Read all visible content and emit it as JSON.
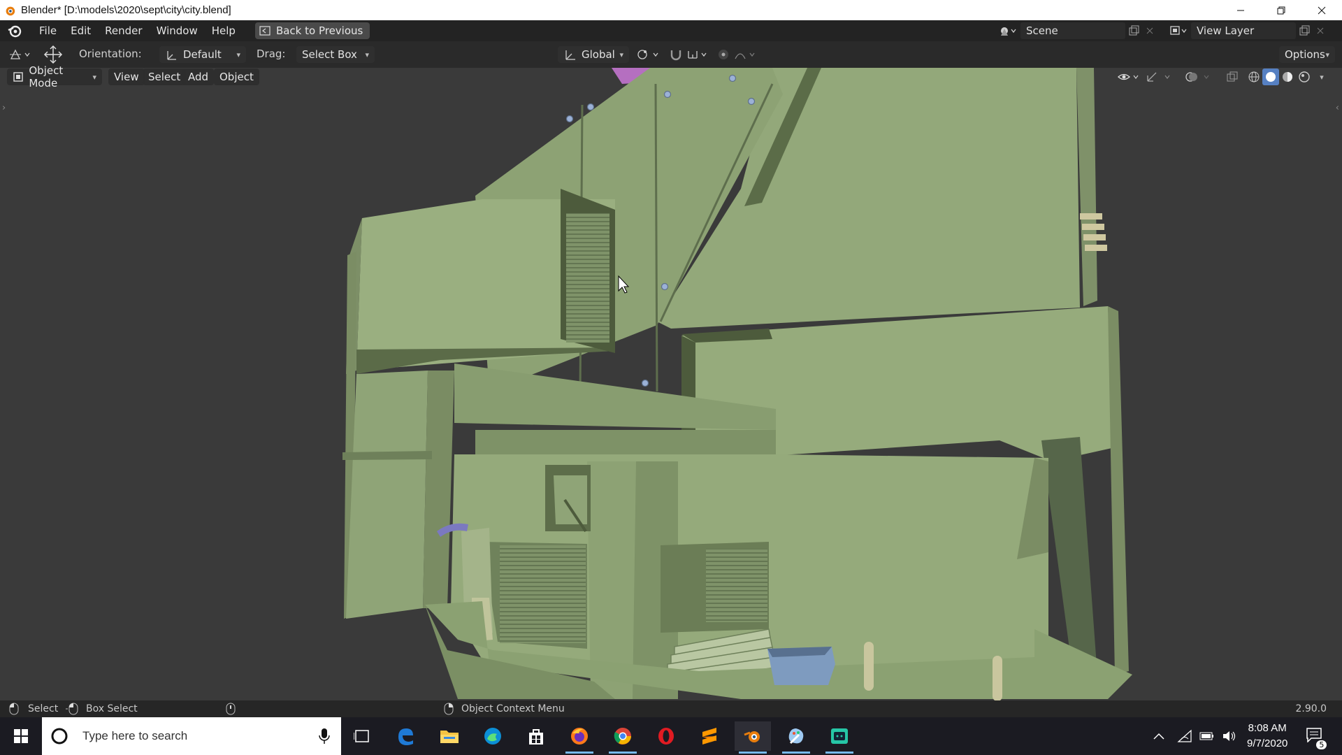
{
  "window": {
    "title": "Blender* [D:\\models\\2020\\sept\\city\\city.blend]"
  },
  "menubar": {
    "items": [
      "File",
      "Edit",
      "Render",
      "Window",
      "Help"
    ],
    "back_button": "Back to Previous",
    "scene": "Scene",
    "view_layer": "View Layer"
  },
  "toolheader": {
    "orientation_label": "Orientation:",
    "orientation_value": "Default",
    "drag_label": "Drag:",
    "drag_value": "Select Box",
    "transform_orientation": "Global",
    "options": "Options"
  },
  "viewport_header": {
    "mode": "Object Mode",
    "menus": [
      "View",
      "Select",
      "Add",
      "Object"
    ]
  },
  "statusbar": {
    "select": "Select",
    "box_select": "Box Select",
    "context_menu": "Object Context Menu",
    "version": "2.90.0"
  },
  "taskbar": {
    "search_placeholder": "Type here to search",
    "time": "8:08 AM",
    "date": "9/7/2020",
    "notification_count": "5",
    "apps": [
      "task-view",
      "edge-legacy",
      "file-explorer",
      "edge",
      "store",
      "firefox",
      "chrome",
      "opera",
      "sublime-text",
      "blender",
      "paint-app",
      "terminal-app"
    ]
  },
  "colors": {
    "model_green": "#93a87a",
    "viewport_bg": "#3a3a3a",
    "accent_blue": "#76b9ed"
  }
}
